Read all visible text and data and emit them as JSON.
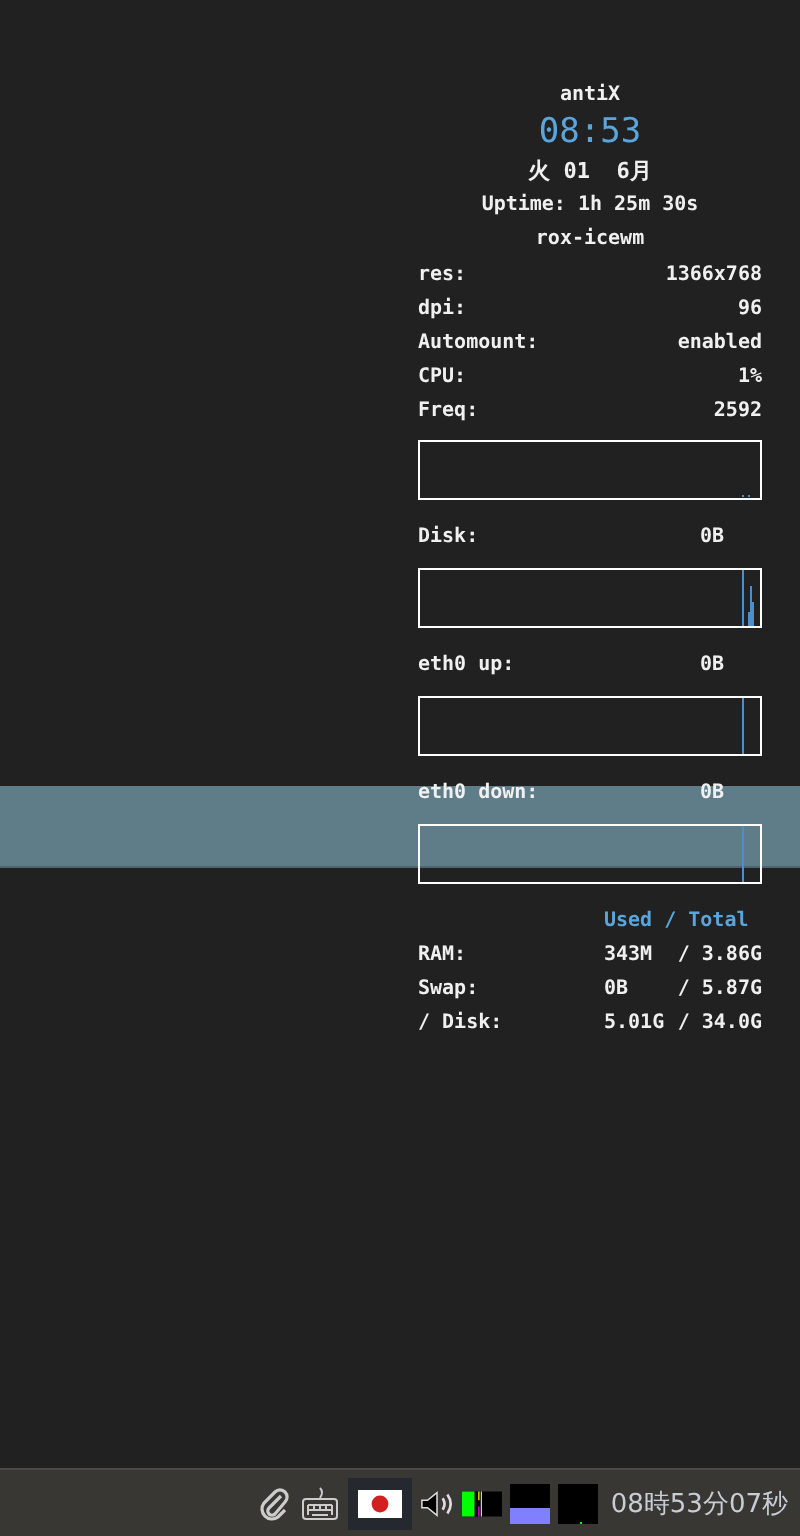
{
  "conky": {
    "title": "antiX",
    "clock": "08:53",
    "date": "火 01  6月",
    "uptime": "Uptime: 1h 25m 30s",
    "session": "rox-icewm",
    "info": [
      {
        "label": "res:",
        "value": "1366x768"
      },
      {
        "label": "dpi:",
        "value": "96"
      },
      {
        "label": "Automount:",
        "value": "enabled"
      },
      {
        "label": "CPU:",
        "value": "1%"
      },
      {
        "label": "Freq:",
        "value": "2592"
      }
    ],
    "graphs": [
      {
        "kind": "cpu"
      },
      {
        "kind": "disk",
        "label": "Disk:",
        "value": "0B"
      },
      {
        "kind": "network",
        "label": "eth0 up:",
        "value": "0B"
      },
      {
        "kind": "network",
        "label": "eth0 down:",
        "value": "0B"
      }
    ],
    "memory": {
      "header": "Used / Total",
      "rows": [
        {
          "label": "RAM:",
          "used": "343M",
          "total": "/ 3.86G"
        },
        {
          "label": "Swap:",
          "used": "0B",
          "total": "/ 5.87G"
        },
        {
          "label": "/ Disk:",
          "used": "5.01G",
          "total": "/ 34.0G"
        }
      ]
    }
  },
  "taskbar": {
    "clock": "08時53分07秒"
  }
}
